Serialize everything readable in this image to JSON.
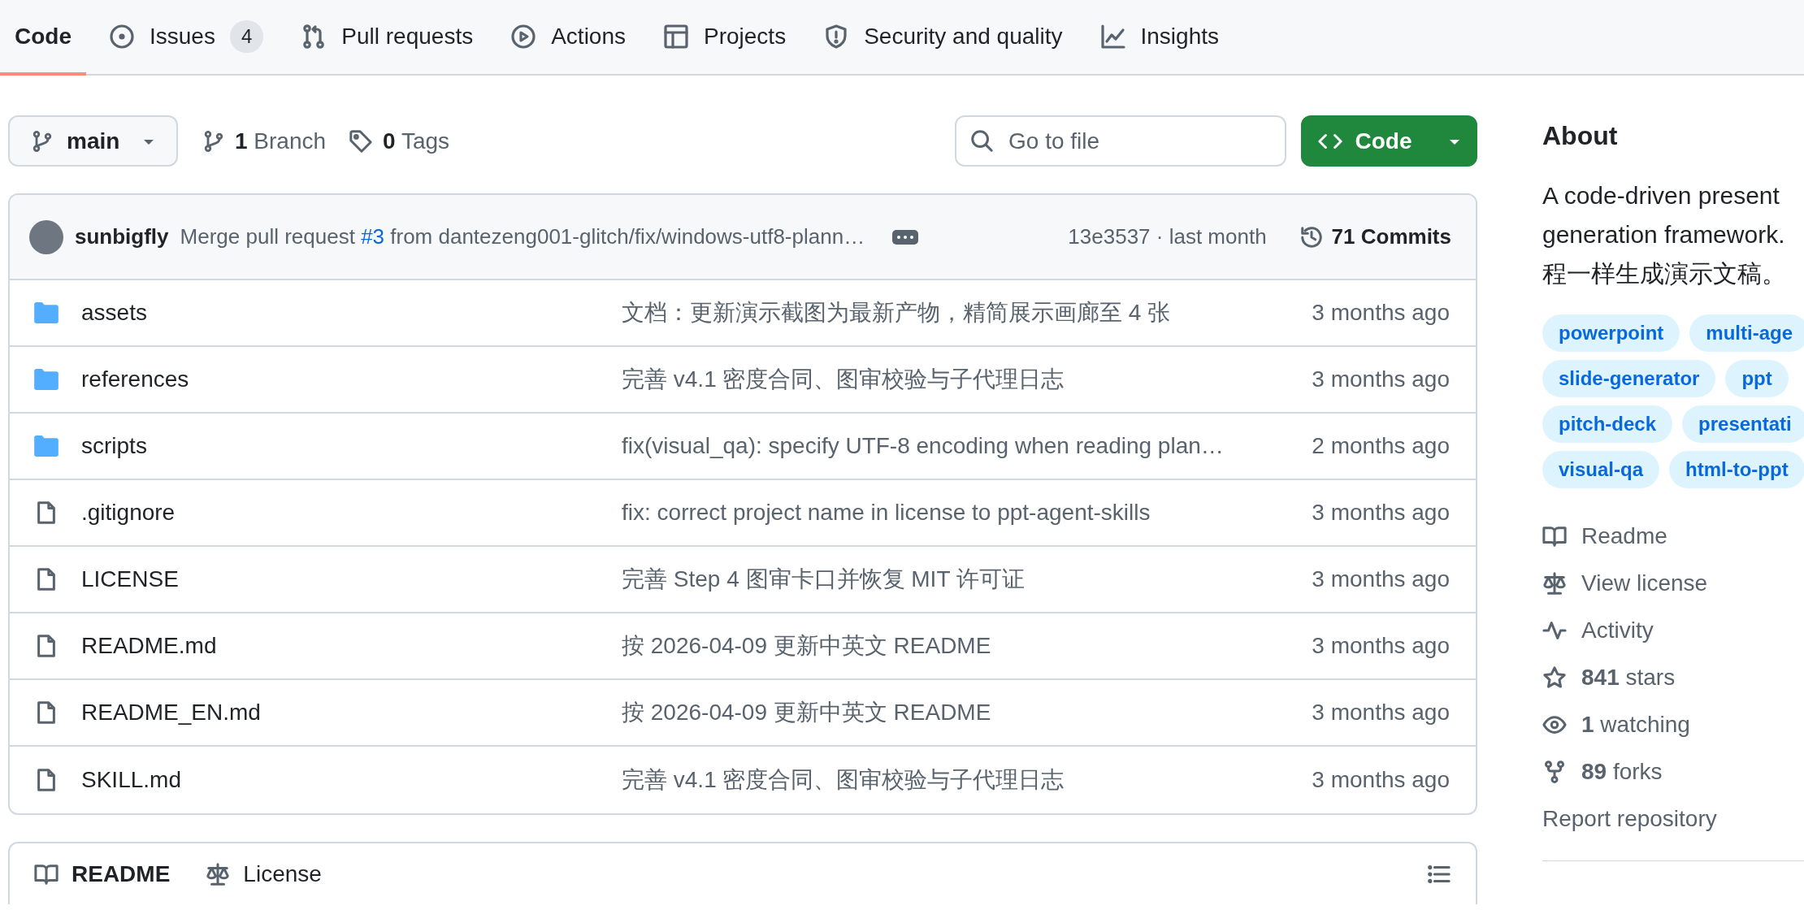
{
  "nav_tabs": [
    {
      "label": "Code",
      "selected": true
    },
    {
      "kind": "issues",
      "label": "Issues",
      "count": "4",
      "selected": false
    },
    {
      "kind": "pulls",
      "label": "Pull requests",
      "selected": false
    },
    {
      "kind": "actions",
      "label": "Actions",
      "selected": false
    },
    {
      "kind": "projects",
      "label": "Projects",
      "selected": false
    },
    {
      "kind": "security",
      "label": "Security and quality",
      "selected": false
    },
    {
      "kind": "insights",
      "label": "Insights",
      "selected": false
    }
  ],
  "branch_selector": {
    "name": "main"
  },
  "branches": {
    "count": "1",
    "label": "Branch"
  },
  "tags": {
    "count": "0",
    "label": "Tags"
  },
  "file_search": {
    "placeholder": "Go to file"
  },
  "code_button": {
    "label": "Code"
  },
  "latest_commit": {
    "author": "sunbigfly",
    "message_prefix": "Merge pull request",
    "pr_link": "#3",
    "message_suffix": "from dantezeng001-glitch/fix/windows-utf8-plann…",
    "sha": "13e3537",
    "separator": "·",
    "time": "last month",
    "commits": "71 Commits"
  },
  "files": [
    {
      "kind": "folder",
      "name": "assets",
      "message": "文档：更新演示截图为最新产物，精简展示画廊至 4 张",
      "time": "3 months ago"
    },
    {
      "kind": "folder",
      "name": "references",
      "message": "完善 v4.1 密度合同、图审校验与子代理日志",
      "time": "3 months ago"
    },
    {
      "kind": "folder",
      "name": "scripts",
      "message": "fix(visual_qa): specify UTF-8 encoding when reading plan…",
      "time": "2 months ago"
    },
    {
      "kind": "file",
      "name": ".gitignore",
      "message": "fix: correct project name in license to ppt-agent-skills",
      "time": "3 months ago"
    },
    {
      "kind": "file",
      "name": "LICENSE",
      "message": "完善 Step 4 图审卡口并恢复 MIT 许可证",
      "time": "3 months ago"
    },
    {
      "kind": "file",
      "name": "README.md",
      "message": "按 2026-04-09 更新中英文 README",
      "time": "3 months ago"
    },
    {
      "kind": "file",
      "name": "README_EN.md",
      "message": "按 2026-04-09 更新中英文 README",
      "time": "3 months ago"
    },
    {
      "kind": "file",
      "name": "SKILL.md",
      "message": "完善 v4.1 密度合同、图审校验与子代理日志",
      "time": "3 months ago"
    }
  ],
  "readme_tabs": [
    {
      "kind": "readme",
      "label": "README",
      "selected": true
    },
    {
      "kind": "license",
      "label": "License",
      "selected": false
    }
  ],
  "about": {
    "title": "About",
    "description_lines": [
      "A code-driven present",
      "generation framework.",
      "程一样生成演示文稿。"
    ],
    "topics": [
      "powerpoint",
      "multi-age",
      "slide-generator",
      "ppt",
      "pitch-deck",
      "presentati",
      "visual-qa",
      "html-to-ppt"
    ],
    "links": [
      {
        "kind": "readme",
        "label": "Readme"
      },
      {
        "kind": "license",
        "label": "View license"
      },
      {
        "kind": "activity",
        "label": "Activity"
      },
      {
        "kind": "stars",
        "count": "841",
        "label": "stars"
      },
      {
        "kind": "watching",
        "count": "1",
        "label": "watching"
      },
      {
        "kind": "forks",
        "count": "89",
        "label": "forks"
      }
    ],
    "report": "Report repository"
  }
}
